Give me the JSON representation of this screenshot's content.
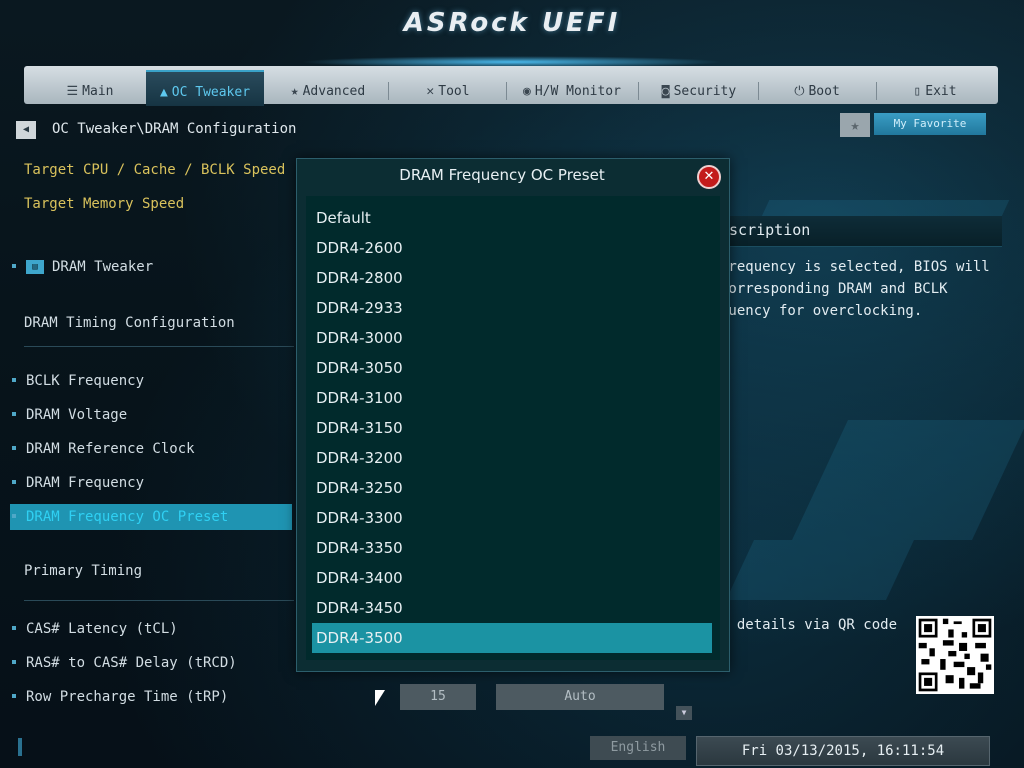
{
  "app": {
    "title": "ASRock UEFI"
  },
  "tabs": [
    {
      "label": "Main",
      "icon": "list-icon"
    },
    {
      "label": "OC Tweaker",
      "icon": "flame-icon",
      "active": true
    },
    {
      "label": "Advanced",
      "icon": "star-icon"
    },
    {
      "label": "Tool",
      "icon": "tools-icon"
    },
    {
      "label": "H/W Monitor",
      "icon": "monitor-icon"
    },
    {
      "label": "Security",
      "icon": "shield-icon"
    },
    {
      "label": "Boot",
      "icon": "power-icon"
    },
    {
      "label": "Exit",
      "icon": "exit-icon"
    }
  ],
  "breadcrumb": "OC Tweaker\\DRAM Configuration",
  "favorite": {
    "label": "My Favorite"
  },
  "left": {
    "target_cpu": "Target CPU / Cache / BCLK Speed",
    "target_mem": "Target Memory Speed",
    "dram_tweaker": "DRAM Tweaker",
    "timing_config": "DRAM Timing Configuration",
    "items": [
      "BCLK Frequency",
      "DRAM Voltage",
      "DRAM Reference Clock",
      "DRAM Frequency",
      "DRAM Frequency OC Preset"
    ],
    "primary_timing": "Primary Timing",
    "timing_items": [
      "CAS# Latency (tCL)",
      "RAS# to CAS# Delay (tRCD)",
      "Row Precharge Time (tRP)"
    ],
    "row_values": {
      "value": "15",
      "mode": "Auto"
    }
  },
  "description": {
    "title": "escription",
    "lines": [
      "frequency is selected, BIOS will",
      "corresponding DRAM and BCLK",
      "quency for overclocking."
    ],
    "qr_text": "t details via QR code"
  },
  "modal": {
    "title": "DRAM Frequency OC Preset",
    "options": [
      "Default",
      "DDR4-2600",
      "DDR4-2800",
      "DDR4-2933",
      "DDR4-3000",
      "DDR4-3050",
      "DDR4-3100",
      "DDR4-3150",
      "DDR4-3200",
      "DDR4-3250",
      "DDR4-3300",
      "DDR4-3350",
      "DDR4-3400",
      "DDR4-3450",
      "DDR4-3500"
    ],
    "selected": "DDR4-3500"
  },
  "footer": {
    "language": "English",
    "datetime": "Fri 03/13/2015, 16:11:54"
  },
  "colors": {
    "accent": "#1f94b2",
    "label_yellow": "#d9c25c",
    "modal_bg": "#012a2c",
    "close_red": "#c31b1b"
  }
}
